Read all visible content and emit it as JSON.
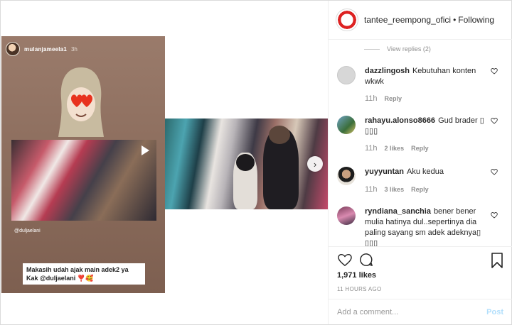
{
  "story": {
    "username": "mulanjameela1",
    "time": "3h",
    "tag": "@duljaelani",
    "caption_line1": "Makasih udah ajak main adek2 ya",
    "caption_line2": "Kak @duljaelani",
    "caption_emoji": "❣️🥰"
  },
  "header": {
    "username": "tantee_reempong_ofici",
    "separator": "•",
    "follow_status": "Following"
  },
  "view_replies": "View replies (2)",
  "comments": [
    {
      "user": "dazzlingosh",
      "text": "Kebutuhan konten wkwk",
      "time": "11h",
      "likes": "",
      "reply": "Reply"
    },
    {
      "user": "rahayu.alonso8666",
      "text": "Gud brader ▯ ▯▯▯",
      "time": "11h",
      "likes": "2 likes",
      "reply": "Reply"
    },
    {
      "user": "yuyyuntan",
      "text": "Aku kedua",
      "time": "11h",
      "likes": "3 likes",
      "reply": "Reply"
    },
    {
      "user": "ryndiana_sanchia",
      "text": "bener bener mulia hatinya dul..sepertinya dia paling sayang sm adek adeknya▯ ▯▯▯",
      "time": "",
      "likes": "",
      "reply": ""
    }
  ],
  "likes_count": "1,971 likes",
  "post_time": "11 HOURS AGO",
  "add_comment": {
    "placeholder": "Add a comment...",
    "post_label": "Post"
  },
  "colors": {
    "accent_post": "#b2dffc",
    "meta_gray": "#8e8e8e",
    "text": "#262626"
  },
  "icons": [
    "heart-icon",
    "comment-icon",
    "bookmark-icon",
    "chevron-right-icon",
    "play-icon"
  ]
}
